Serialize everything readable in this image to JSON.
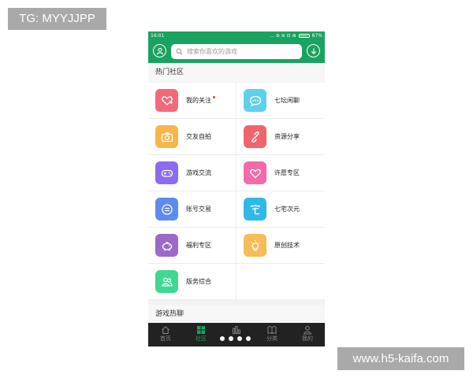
{
  "watermarks": {
    "top_left": "TG: MYYJJPP",
    "bottom_right": "www.h5-kaifa.com"
  },
  "status_bar": {
    "time": "16:01",
    "indicators": "... ⊘ ≋ ⊡ ⊛",
    "battery": "87%"
  },
  "header": {
    "search_placeholder": "搜索你喜欢的游戏",
    "left_icon": "user-icon",
    "right_icon": "download-icon"
  },
  "community": {
    "title": "热门社区",
    "items": [
      {
        "label": "我的关注",
        "icon": "heart-plus-icon",
        "color": "#f2697a",
        "has_dot": true
      },
      {
        "label": "七坛闲聊",
        "icon": "chat-bubble-icon",
        "color": "#5fd0ec"
      },
      {
        "label": "交友自拍",
        "icon": "camera-icon",
        "color": "#f7b64a"
      },
      {
        "label": "资源分享",
        "icon": "link-icon",
        "color": "#f0656d"
      },
      {
        "label": "游戏交流",
        "icon": "gamepad-icon",
        "color": "#8b6cf0"
      },
      {
        "label": "许愿专区",
        "icon": "heart-icon",
        "color": "#f46aa8"
      },
      {
        "label": "账号交易",
        "icon": "coin-icon",
        "color": "#5c8cf0"
      },
      {
        "label": "七宅次元",
        "icon": "zhai-icon",
        "color": "#2fb8e8"
      },
      {
        "label": "福利专区",
        "icon": "piggy-bank-icon",
        "color": "#9a6ac8"
      },
      {
        "label": "原创技术",
        "icon": "lightbulb-icon",
        "color": "#f7bc55"
      },
      {
        "label": "版务综合",
        "icon": "users-icon",
        "color": "#3ed892"
      }
    ]
  },
  "game_chat": {
    "title": "游戏热聊"
  },
  "tabbar": {
    "tabs": [
      {
        "label": "首页",
        "icon": "home-icon",
        "active": false
      },
      {
        "label": "社区",
        "icon": "grid-icon",
        "active": true
      },
      {
        "label": "",
        "icon": "chart-icon",
        "active": false
      },
      {
        "label": "分类",
        "icon": "book-icon",
        "active": false
      },
      {
        "label": "我的",
        "icon": "person-icon",
        "active": false
      }
    ]
  },
  "pager": {
    "count": 4,
    "current": 2
  }
}
